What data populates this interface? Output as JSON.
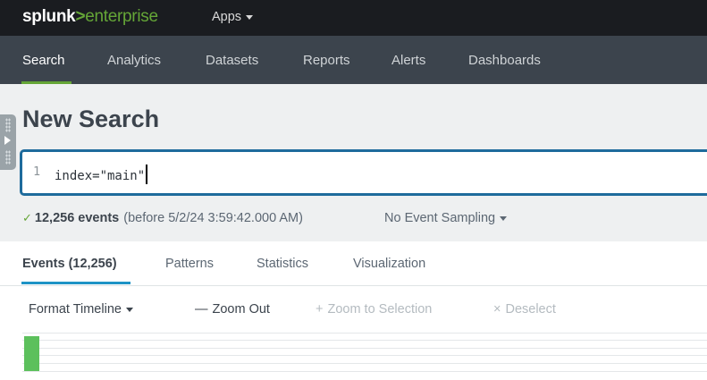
{
  "app": {
    "logo_part1": "splunk",
    "logo_part2": ">",
    "logo_part3": "enterprise",
    "apps_label": "Apps"
  },
  "nav": {
    "items": [
      {
        "label": "Search",
        "active": true
      },
      {
        "label": "Analytics"
      },
      {
        "label": "Datasets"
      },
      {
        "label": "Reports"
      },
      {
        "label": "Alerts"
      },
      {
        "label": "Dashboards"
      }
    ]
  },
  "page": {
    "title": "New Search"
  },
  "search": {
    "line_number": "1",
    "query": "index=\"main\""
  },
  "status": {
    "check_icon": "checkmark-icon",
    "event_count": "12,256 events",
    "timestamp": "(before 5/2/24 3:59:42.000 AM)",
    "sampling": "No Event Sampling"
  },
  "tabs": [
    {
      "label": "Events (12,256)",
      "active": true
    },
    {
      "label": "Patterns"
    },
    {
      "label": "Statistics"
    },
    {
      "label": "Visualization"
    }
  ],
  "timeline_controls": {
    "format_timeline": "Format Timeline",
    "zoom_out": "Zoom Out",
    "zoom_to_selection": "Zoom to Selection",
    "deselect": "Deselect"
  },
  "colors": {
    "accent_green": "#65a637",
    "tab_blue": "#1e93c6",
    "search_border": "#1e6b9c"
  }
}
